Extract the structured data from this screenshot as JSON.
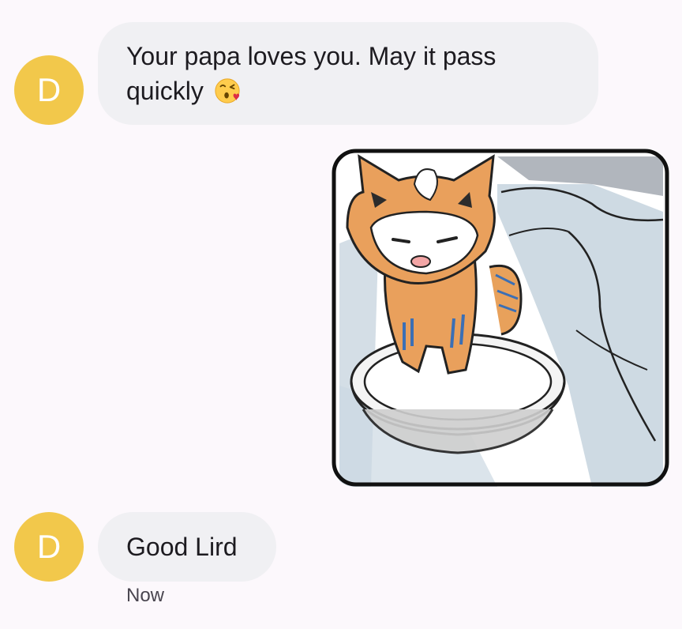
{
  "conversation": {
    "messages": [
      {
        "sender_initial": "D",
        "text": "Your papa loves you. May it pass quickly",
        "emoji": "kissing-face-icon"
      },
      {
        "type": "image",
        "description_icon": "cat-in-bowl-drawing"
      },
      {
        "sender_initial": "D",
        "text": "Good Lird"
      }
    ],
    "last_timestamp": "Now"
  },
  "colors": {
    "avatar": "#f2c84b",
    "bubble": "#f0f0f3",
    "background": "#fcf8fc",
    "text": "#1d1b20",
    "timestamp": "#49454f"
  }
}
